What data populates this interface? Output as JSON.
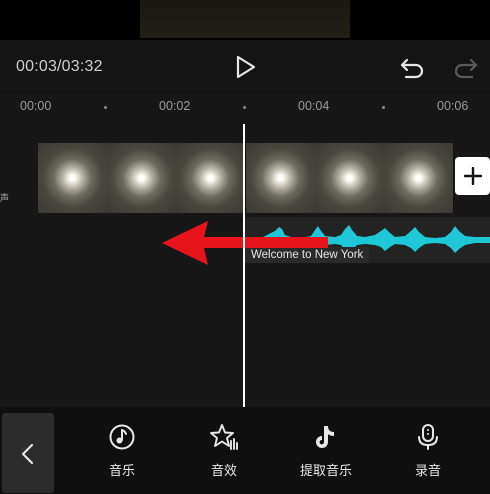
{
  "playback": {
    "timecode": "00:03/03:32"
  },
  "ruler": {
    "ticks": [
      "00:00",
      "00:02",
      "00:04",
      "00:06"
    ]
  },
  "track": {
    "side_label": "声"
  },
  "audio": {
    "clip_title": "Welcome to New York",
    "wave_color": "#1ec8d6"
  },
  "toolbar": {
    "items": [
      {
        "label": "音乐",
        "icon": "music-note-icon"
      },
      {
        "label": "音效",
        "icon": "sound-effect-star-icon"
      },
      {
        "label": "提取音乐",
        "icon": "tiktok-note-icon"
      },
      {
        "label": "录音",
        "icon": "microphone-icon"
      }
    ]
  },
  "colors": {
    "arrow": "#e8141c",
    "accent": "#1ec8d6"
  }
}
